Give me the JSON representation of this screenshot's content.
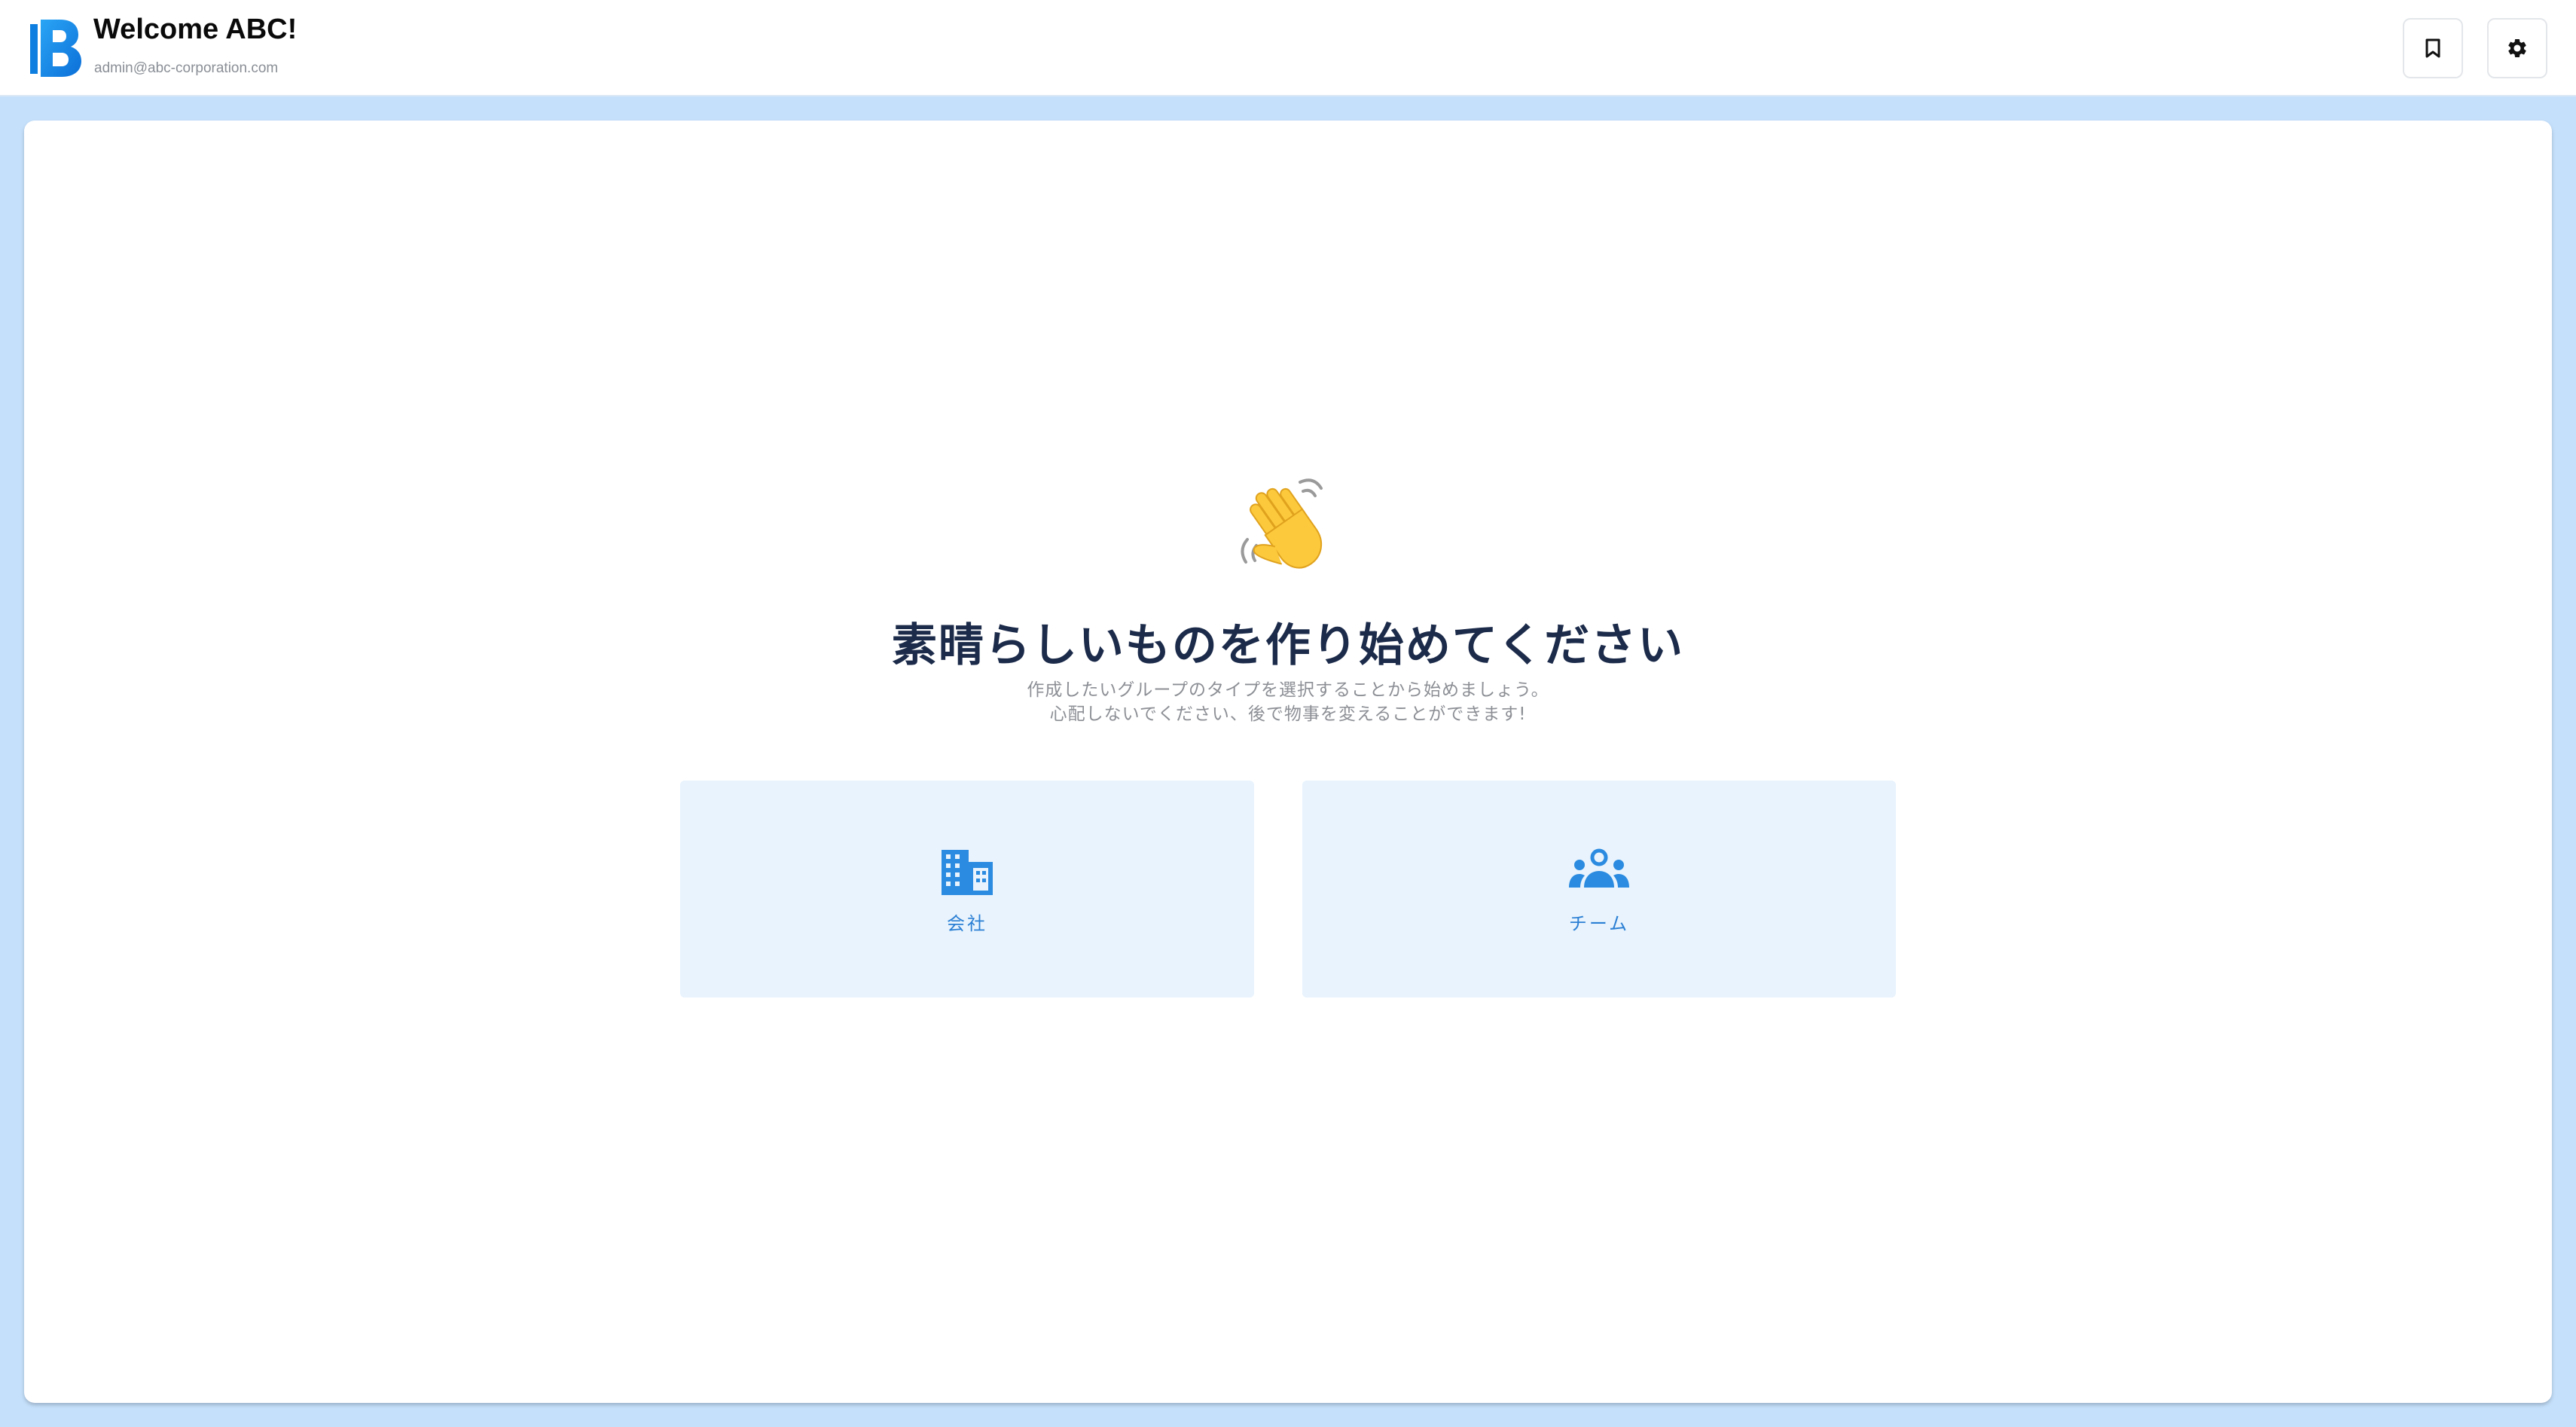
{
  "header": {
    "title": "Welcome ABC!",
    "email": "admin@abc-corporation.com",
    "bookmark_icon": "bookmark-icon",
    "settings_icon": "gear-icon",
    "logo_icon": "brand-logo-b",
    "brand_color": "#1a8fe8"
  },
  "main": {
    "emoji_icon": "waving-hand-icon",
    "heading": "素晴らしいものを作り始めてください",
    "subtitle_line1": "作成したいグループのタイプを選択することから始めましょう。",
    "subtitle_line2": "心配しないでください、後で物事を変えることができます!",
    "options": [
      {
        "label": "会社",
        "icon": "building-icon"
      },
      {
        "label": "チーム",
        "icon": "group-icon"
      }
    ],
    "option_bg": "#e8f3fd",
    "option_accent": "#2b7fd4"
  }
}
